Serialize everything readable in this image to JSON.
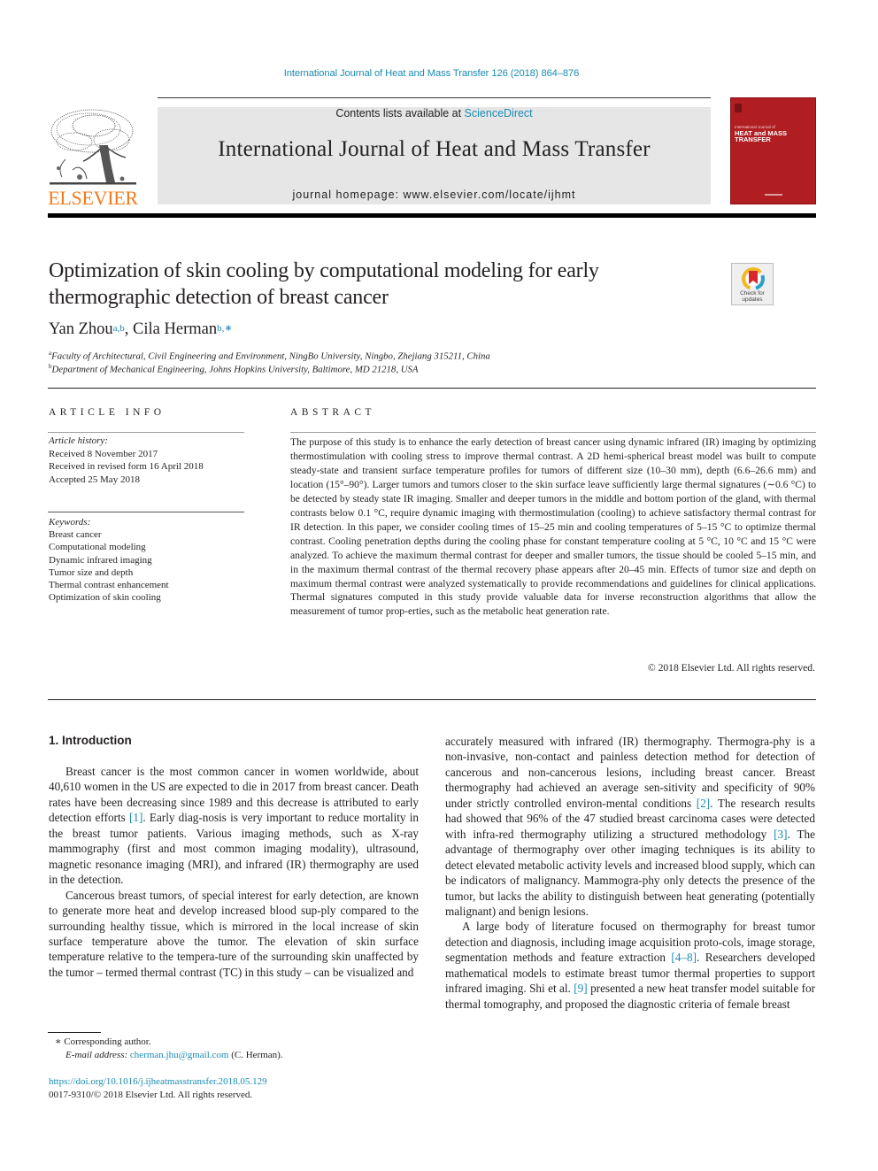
{
  "running_head": "International Journal of Heat and Mass Transfer 126 (2018) 864–876",
  "masthead": {
    "contents_prefix": "Contents lists available at ",
    "contents_link": "ScienceDirect",
    "journal_name": "International Journal of Heat and Mass Transfer",
    "homepage": "journal homepage: www.elsevier.com/locate/ijhmt",
    "publisher_wordmark": "ELSEVIER",
    "publisher_logo_icon": "elsevier-tree-icon",
    "cover": {
      "small_title": "International Journal of",
      "big_title_line1": "HEAT and MASS",
      "big_title_line2": "TRANSFER",
      "color": "#b01e22"
    }
  },
  "article": {
    "title": "Optimization of skin cooling by computational modeling for early thermographic detection of breast cancer",
    "crossmark": {
      "icon": "crossmark-icon",
      "label_line1": "Check for",
      "label_line2": "updates"
    },
    "authors": [
      {
        "name": "Yan Zhou",
        "sup": "a,b"
      },
      {
        "name": "Cila Herman",
        "sup": "b,∗"
      }
    ],
    "author_separator": ", ",
    "affiliations": [
      {
        "mark": "a",
        "text": "Faculty of Architectural, Civil Engineering and Environment, NingBo University, Ningbo, Zhejiang 315211, China"
      },
      {
        "mark": "b",
        "text": "Department of Mechanical Engineering, Johns Hopkins University, Baltimore, MD 21218, USA"
      }
    ]
  },
  "article_info": {
    "heading": "ARTICLE INFO",
    "history_label": "Article history:",
    "history": [
      "Received 8 November 2017",
      "Received in revised form 16 April 2018",
      "Accepted 25 May 2018"
    ],
    "keywords_label": "Keywords:",
    "keywords": [
      "Breast cancer",
      "Computational modeling",
      "Dynamic infrared imaging",
      "Tumor size and depth",
      "Thermal contrast enhancement",
      "Optimization of skin cooling"
    ]
  },
  "abstract": {
    "heading": "ABSTRACT",
    "text": "The purpose of this study is to enhance the early detection of breast cancer using dynamic infrared (IR) imaging by optimizing thermostimulation with cooling stress to improve thermal contrast. A 2D hemi-spherical breast model was built to compute steady-state and transient surface temperature profiles for tumors of different size (10–30 mm), depth (6.6–26.6 mm) and location (15°–90°). Larger tumors and tumors closer to the skin surface leave sufficiently large thermal signatures (∼0.6 °C) to be detected by steady state IR imaging. Smaller and deeper tumors in the middle and bottom portion of the gland, with thermal contrasts below 0.1 °C, require dynamic imaging with thermostimulation (cooling) to achieve satisfactory thermal contrast for IR detection. In this paper, we consider cooling times of 15–25 min and cooling temperatures of 5–15 °C to optimize thermal contrast. Cooling penetration depths during the cooling phase for constant temperature cooling at 5 °C, 10 °C and 15 °C were analyzed. To achieve the maximum thermal contrast for deeper and smaller tumors, the tissue should be cooled 5–15 min, and in the maximum thermal contrast of the thermal recovery phase appears after 20–45 min. Effects of tumor size and depth on maximum thermal contrast were analyzed systematically to provide recommendations and guidelines for clinical applications. Thermal signatures computed in this study provide valuable data for inverse reconstruction algorithms that allow the measurement of tumor prop-erties, such as the metabolic heat generation rate.",
    "copyright": "© 2018 Elsevier Ltd. All rights reserved."
  },
  "body": {
    "section_heading": "1. Introduction",
    "left_paragraphs": [
      {
        "parts": [
          {
            "t": "Breast cancer is the most common cancer in women worldwide, about 40,610 women in the US are expected to die in 2017 from breast cancer. Death rates have been decreasing since 1989 and this decrease is attributed to early detection efforts "
          },
          {
            "ref": "[1]"
          },
          {
            "t": ". Early diag-nosis is very important to reduce mortality in the breast tumor patients. Various imaging methods, such as X-ray mammography (first and most common imaging modality), ultrasound, magnetic resonance imaging (MRI), and infrared (IR) thermography are used in the detection."
          }
        ]
      },
      {
        "parts": [
          {
            "t": "Cancerous breast tumors, of special interest for early detection, are known to generate more heat and develop increased blood sup-ply compared to the surrounding healthy tissue, which is mirrored in the local increase of skin surface temperature above the tumor. The elevation of skin surface temperature relative to the tempera-ture of the surrounding skin unaffected by the tumor – termed thermal contrast (TC) in this study – can be visualized and"
          }
        ]
      }
    ],
    "right_paragraphs": [
      {
        "continued": true,
        "parts": [
          {
            "t": "accurately measured with infrared (IR) thermography. Thermogra-phy is a non-invasive, non-contact and painless detection method for detection of cancerous and non-cancerous lesions, including breast cancer. Breast thermography had achieved an average sen-sitivity and specificity of 90% under strictly controlled environ-mental conditions "
          },
          {
            "ref": "[2]"
          },
          {
            "t": ". The research results had showed that 96% of the 47 studied breast carcinoma cases were detected with infra-red thermography utilizing a structured methodology "
          },
          {
            "ref": "[3]"
          },
          {
            "t": ". The advantage of thermography over other imaging techniques is its ability to detect elevated metabolic activity levels and increased blood supply, which can be indicators of malignancy. Mammogra-phy only detects the presence of the tumor, but lacks the ability to distinguish between heat generating (potentially malignant) and benign lesions."
          }
        ]
      },
      {
        "continued": false,
        "parts": [
          {
            "t": "A large body of literature focused on thermography for breast tumor detection and diagnosis, including image acquisition proto-cols, image storage, segmentation methods and feature extraction "
          },
          {
            "ref": "[4–8]"
          },
          {
            "t": ". Researchers developed mathematical models to estimate breast tumor thermal properties to support infrared imaging. Shi et al. "
          },
          {
            "ref": "[9]"
          },
          {
            "t": " presented a new heat transfer model suitable for thermal tomography, and proposed the diagnostic criteria of female breast"
          }
        ]
      }
    ]
  },
  "footnotes": {
    "corresponding_mark": "∗",
    "corresponding_text": "Corresponding author.",
    "email_label": "E-mail address: ",
    "email": "cherman.jhu@gmail.com",
    "email_suffix": " (C. Herman).",
    "doi": "https://doi.org/10.1016/j.ijheatmasstransfer.2018.05.129",
    "issn_line": "0017-9310/© 2018 Elsevier Ltd. All rights reserved."
  },
  "colors": {
    "link": "#1a8bb3",
    "elsevier_orange": "#f07a1b",
    "masthead_band": "#e6e6e6",
    "cover_red": "#b01e22"
  }
}
